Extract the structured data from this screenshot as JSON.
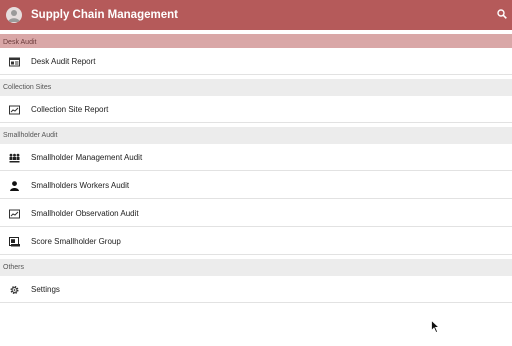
{
  "appbar": {
    "title": "Supply Chain Management",
    "avatar_icon": "user-avatar-icon",
    "search_icon": "search-icon",
    "color": "#b55a5a"
  },
  "sections": [
    {
      "header": "Desk Audit",
      "items": [
        {
          "label": "Desk Audit Report",
          "icon": "report-icon"
        }
      ]
    },
    {
      "header": "Collection Sites",
      "items": [
        {
          "label": "Collection Site Report",
          "icon": "chart-icon"
        }
      ]
    },
    {
      "header": "Smallholder Audit",
      "items": [
        {
          "label": "Smallholder Management Audit",
          "icon": "group-icon"
        },
        {
          "label": "Smallholders Workers Audit",
          "icon": "person-icon"
        },
        {
          "label": "Smallholder Observation Audit",
          "icon": "chart-icon"
        },
        {
          "label": "Score Smallholder Group",
          "icon": "score-icon"
        }
      ]
    },
    {
      "header": "Others",
      "items": [
        {
          "label": "Settings",
          "icon": "gear-icon"
        }
      ]
    }
  ]
}
